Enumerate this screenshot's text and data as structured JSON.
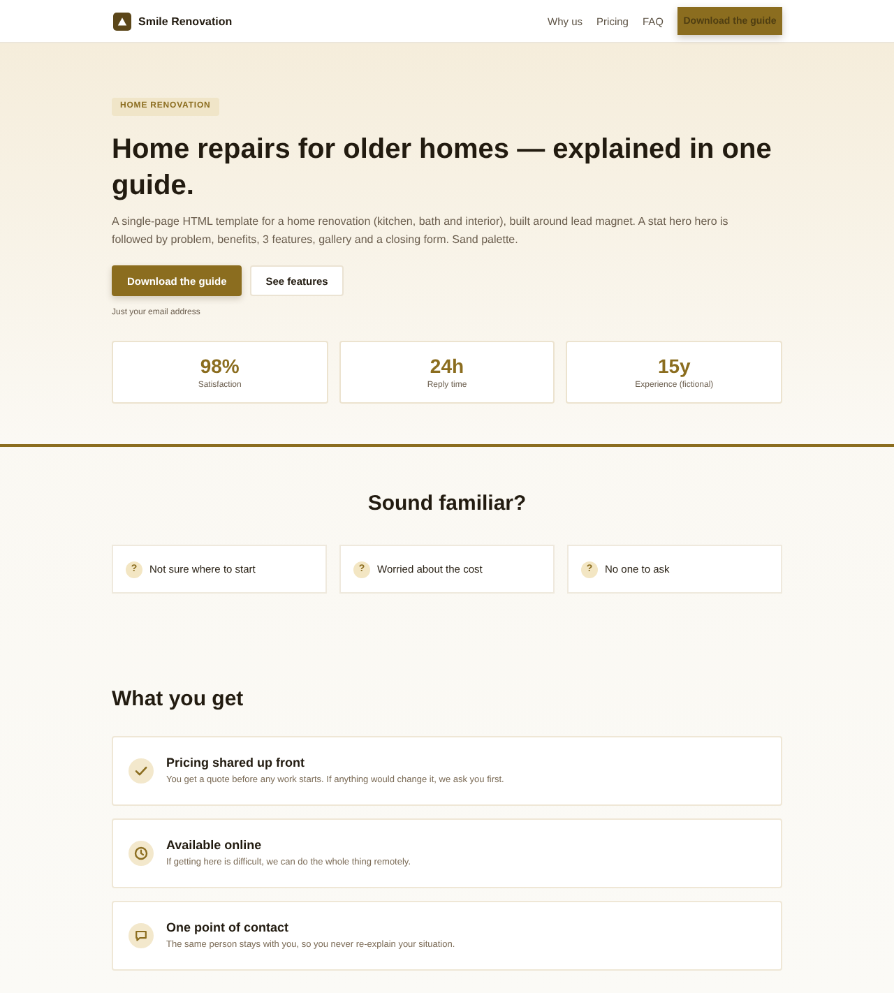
{
  "header": {
    "brand": "Smile Renovation",
    "nav": [
      {
        "label": "Why us"
      },
      {
        "label": "Pricing"
      },
      {
        "label": "FAQ"
      }
    ],
    "cta": "Download the guide"
  },
  "hero": {
    "eyebrow": "HOME RENOVATION",
    "title": "Home repairs for older homes — explained in one guide.",
    "lead": "A single-page HTML template for a home renovation (kitchen, bath and interior), built around lead magnet. A stat hero hero is followed by problem, benefits, 3 features, gallery and a closing form. Sand palette.",
    "buttons": [
      {
        "label": "Download the guide",
        "kind": "primary"
      },
      {
        "label": "See features",
        "kind": "secondary"
      }
    ],
    "note": "Just your email address",
    "stats": [
      {
        "value": "98%",
        "label": "Satisfaction"
      },
      {
        "value": "24h",
        "label": "Reply time"
      },
      {
        "value": "15y",
        "label": "Experience (fictional)"
      }
    ]
  },
  "problems": {
    "title": "Sound familiar?",
    "items": [
      {
        "mark": "?",
        "text": "Not sure where to start"
      },
      {
        "mark": "?",
        "text": "Worried about the cost"
      },
      {
        "mark": "?",
        "text": "No one to ask"
      }
    ]
  },
  "benefits": {
    "title": "What you get",
    "items": [
      {
        "kind": "check",
        "title": "Pricing shared up front",
        "text": "You get a quote before any work starts. If anything would change it, we ask you first."
      },
      {
        "kind": "clock",
        "title": "Available online",
        "text": "If getting here is difficult, we can do the whole thing remotely."
      },
      {
        "kind": "message",
        "title": "One point of contact",
        "text": "The same person stays with you, so you never re-explain your situation."
      }
    ]
  }
}
